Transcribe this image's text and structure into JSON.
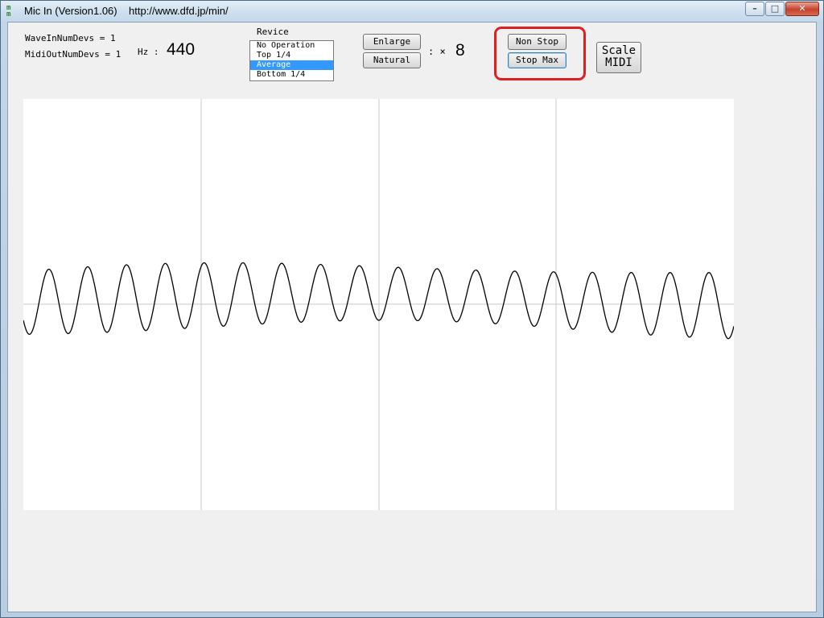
{
  "window": {
    "title": "Mic In (Version1.06)    http://www.dfd.jp/min/",
    "app_icon": "mic-in-app-icon",
    "controls": {
      "minimize": "–",
      "maximize": "□",
      "close": "✕"
    }
  },
  "info": {
    "wave_in": "WaveInNumDevs = 1",
    "midi_out": "MidiOutNumDevs = 1",
    "hz_label": "Hz :",
    "hz_value": "440"
  },
  "revice": {
    "label": "Revice",
    "options": [
      "No Operation",
      "Top 1/4",
      "Average",
      "Bottom 1/4"
    ],
    "selected": "Average"
  },
  "zoom": {
    "enlarge_label": "Enlarge",
    "natural_label": "Natural",
    "times_label": ": ×",
    "factor": "8"
  },
  "stop": {
    "non_stop_label": "Non Stop",
    "stop_max_label": "Stop Max"
  },
  "scale": {
    "line1": "Scale",
    "line2": "MIDI"
  },
  "chart_data": {
    "type": "line",
    "title": "",
    "grid": "vertical lines at quarter divisions, horizontal center line",
    "x_divisions": 4,
    "series": [
      {
        "wave": "sine",
        "cycles": 18.3,
        "stroke": "#000000"
      }
    ]
  },
  "colors": {
    "highlight": "#e02020",
    "selection": "#3399ff",
    "grid": "#c8c8c8"
  }
}
